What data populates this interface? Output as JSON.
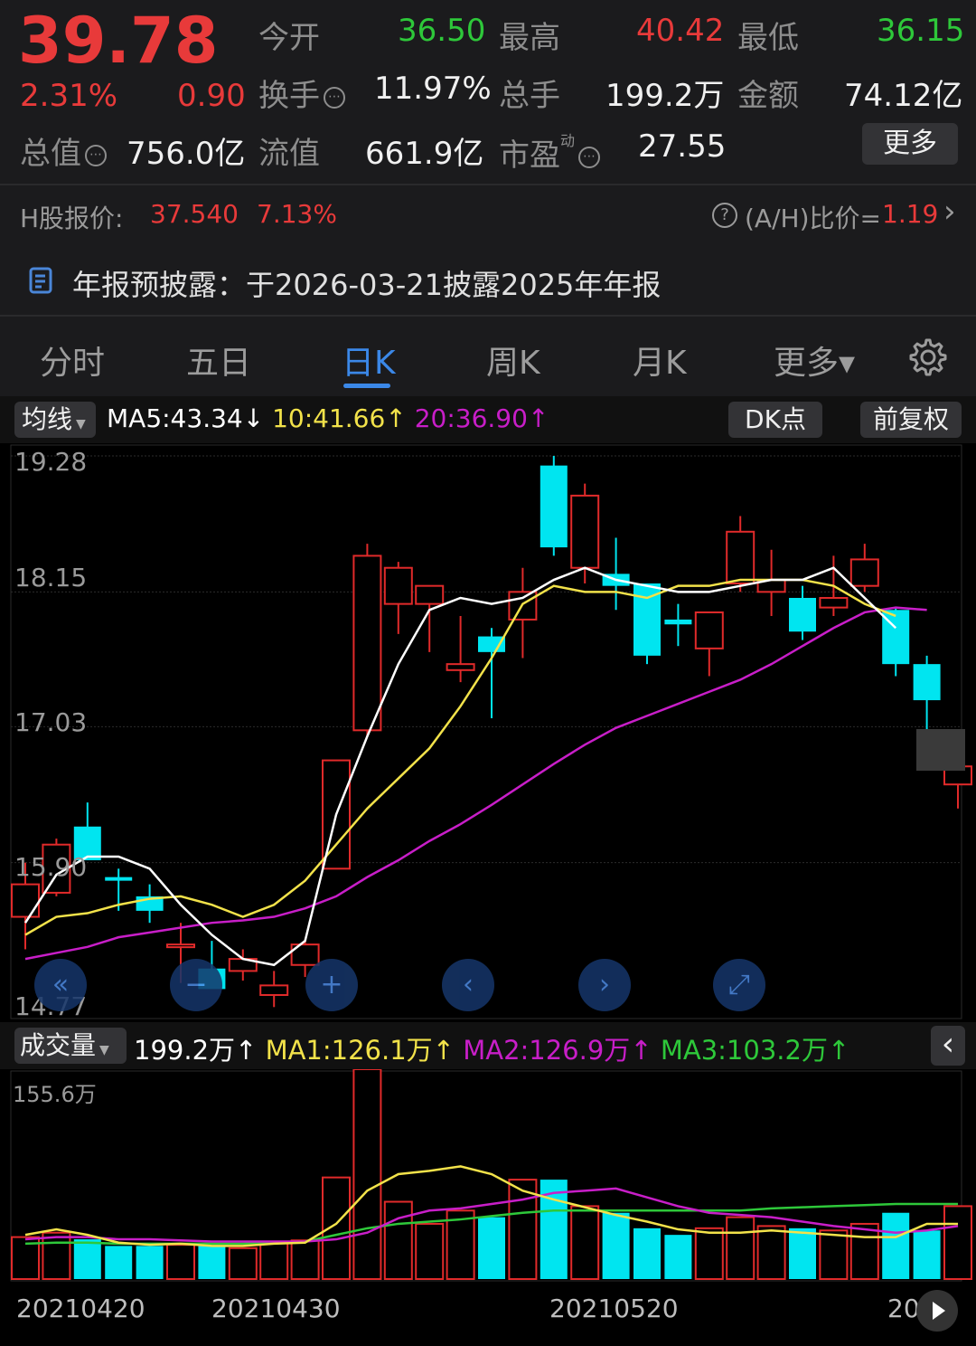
{
  "quote": {
    "price": "39.78",
    "change_pct": "2.31%",
    "change_amt": "0.90",
    "open_label": "今开",
    "open_value": "36.50",
    "high_label": "最高",
    "high_value": "40.42",
    "low_label": "最低",
    "low_value": "36.15",
    "turnover_label": "换手",
    "turnover_value": "11.97%",
    "volume_label": "总手",
    "volume_value": "199.2万",
    "amount_label": "金额",
    "amount_value": "74.12亿",
    "mktcap_label": "总值",
    "mktcap_value": "756.0亿",
    "float_label": "流值",
    "float_value": "661.9亿",
    "pe_label": "市盈",
    "pe_sup": "动",
    "pe_value": "27.55",
    "more_button": "更多",
    "info_glyph": "⋯"
  },
  "hshare": {
    "label": "H股报价:",
    "price": "37.540",
    "pct": "7.13%",
    "ratio_label": "(A/H)比价=",
    "ratio_value": "1.19",
    "help_glyph": "?",
    "arrow_glyph": "›"
  },
  "notice": {
    "text": "年报预披露：于2026-03-21披露2025年年报"
  },
  "tabs": [
    {
      "label": "分时",
      "active": false
    },
    {
      "label": "五日",
      "active": false
    },
    {
      "label": "日K",
      "active": true
    },
    {
      "label": "周K",
      "active": false
    },
    {
      "label": "月K",
      "active": false
    },
    {
      "label": "更多▾",
      "active": false
    }
  ],
  "ma_bar": {
    "selector": "均线",
    "ma5": "MA5:43.34",
    "ma5_arrow": "↓",
    "ma10": "10:41.66",
    "ma10_arrow": "↑",
    "ma20": "20:36.90",
    "ma20_arrow": "↑",
    "dk_button": "DK点",
    "adjust_button": "前复权"
  },
  "price_axis": [
    "19.28",
    "18.15",
    "17.03",
    "15.90",
    "14.77"
  ],
  "nav_buttons": {
    "first": "«",
    "zoom_out": "−",
    "zoom_in": "+",
    "prev": "‹",
    "next": "›",
    "fullscreen": "⤢"
  },
  "vol_bar": {
    "selector": "成交量",
    "vol": "199.2万",
    "vol_arrow": "↑",
    "ma1": "MA1:126.1万",
    "ma1_arrow": "↑",
    "ma2": "MA2:126.9万",
    "ma2_arrow": "↑",
    "ma3": "MA3:103.2万",
    "ma3_arrow": "↑",
    "collapse": "‹"
  },
  "vol_axis_top": "155.6万",
  "dates": [
    "20210420",
    "20210430",
    "20210520",
    "20"
  ],
  "colors": {
    "up": "#e02a2a",
    "down": "#00e5f0",
    "ma5": "#ffffff",
    "ma10": "#f2e24a",
    "ma20": "#c81ec8",
    "vma3": "#2ec83a",
    "accent": "#3b88e8"
  },
  "chart_data": {
    "type": "candlestick",
    "price_range": [
      14.77,
      19.28
    ],
    "candles": [
      {
        "o": 15.45,
        "h": 15.9,
        "l": 15.18,
        "c": 15.72
      },
      {
        "o": 15.65,
        "h": 16.1,
        "l": 15.62,
        "c": 16.05
      },
      {
        "o": 16.2,
        "h": 16.4,
        "l": 15.95,
        "c": 15.92
      },
      {
        "o": 15.78,
        "h": 15.85,
        "l": 15.5,
        "c": 15.75
      },
      {
        "o": 15.62,
        "h": 15.72,
        "l": 15.4,
        "c": 15.5
      },
      {
        "o": 15.22,
        "h": 15.4,
        "l": 14.9,
        "c": 15.22
      },
      {
        "o": 15.02,
        "h": 15.25,
        "l": 14.9,
        "c": 14.85
      },
      {
        "o": 15.0,
        "h": 15.18,
        "l": 14.92,
        "c": 15.1
      },
      {
        "o": 14.8,
        "h": 15.0,
        "l": 14.7,
        "c": 14.88
      },
      {
        "o": 15.05,
        "h": 15.25,
        "l": 14.95,
        "c": 15.22
      },
      {
        "o": 15.85,
        "h": 16.7,
        "l": 15.85,
        "c": 16.75
      },
      {
        "o": 17.0,
        "h": 18.55,
        "l": 16.95,
        "c": 18.45
      },
      {
        "o": 18.05,
        "h": 18.4,
        "l": 17.8,
        "c": 18.35
      },
      {
        "o": 18.05,
        "h": 18.2,
        "l": 17.65,
        "c": 18.2
      },
      {
        "o": 17.5,
        "h": 17.95,
        "l": 17.4,
        "c": 17.55
      },
      {
        "o": 17.78,
        "h": 17.85,
        "l": 17.1,
        "c": 17.65
      },
      {
        "o": 17.92,
        "h": 18.35,
        "l": 17.6,
        "c": 18.15
      },
      {
        "o": 19.2,
        "h": 19.28,
        "l": 18.45,
        "c": 18.52
      },
      {
        "o": 18.35,
        "h": 19.05,
        "l": 18.22,
        "c": 18.95
      },
      {
        "o": 18.3,
        "h": 18.6,
        "l": 18.0,
        "c": 18.2
      },
      {
        "o": 18.22,
        "h": 18.22,
        "l": 17.55,
        "c": 17.62
      },
      {
        "o": 17.92,
        "h": 18.05,
        "l": 17.7,
        "c": 17.88
      },
      {
        "o": 17.68,
        "h": 17.92,
        "l": 17.45,
        "c": 17.98
      },
      {
        "o": 18.22,
        "h": 18.78,
        "l": 18.15,
        "c": 18.65
      },
      {
        "o": 18.15,
        "h": 18.5,
        "l": 17.95,
        "c": 18.25
      },
      {
        "o": 18.1,
        "h": 18.2,
        "l": 17.75,
        "c": 17.82
      },
      {
        "o": 18.02,
        "h": 18.45,
        "l": 17.95,
        "c": 18.1
      },
      {
        "o": 18.2,
        "h": 18.55,
        "l": 18.15,
        "c": 18.42
      },
      {
        "o": 18.0,
        "h": 18.02,
        "l": 17.45,
        "c": 17.55
      },
      {
        "o": 17.55,
        "h": 17.62,
        "l": 17.0,
        "c": 17.25
      },
      {
        "o": 16.55,
        "h": 16.72,
        "l": 16.35,
        "c": 16.7
      }
    ],
    "ma5": [
      15.4,
      15.8,
      15.95,
      15.95,
      15.85,
      15.55,
      15.3,
      15.1,
      15.05,
      15.25,
      16.3,
      16.95,
      17.55,
      18.0,
      18.1,
      18.05,
      18.1,
      18.25,
      18.35,
      18.25,
      18.2,
      18.15,
      18.15,
      18.2,
      18.25,
      18.25,
      18.35,
      18.1,
      17.85,
      null,
      null
    ],
    "ma10": [
      15.3,
      15.45,
      15.48,
      15.55,
      15.6,
      15.62,
      15.55,
      15.45,
      15.55,
      15.75,
      16.05,
      16.35,
      16.6,
      16.85,
      17.2,
      17.6,
      18.05,
      18.2,
      18.15,
      18.15,
      18.1,
      18.2,
      18.2,
      18.25,
      18.25,
      18.25,
      18.2,
      18.05,
      17.95,
      null,
      null
    ],
    "ma20": [
      15.1,
      15.15,
      15.2,
      15.28,
      15.32,
      15.36,
      15.4,
      15.42,
      15.45,
      15.52,
      15.62,
      15.78,
      15.92,
      16.08,
      16.22,
      16.38,
      16.55,
      16.72,
      16.88,
      17.02,
      17.12,
      17.22,
      17.32,
      17.42,
      17.55,
      17.7,
      17.85,
      17.98,
      18.02,
      18.0,
      null
    ],
    "volume_max": "155.6万",
    "volumes": [
      0.38,
      0.42,
      0.36,
      0.3,
      0.3,
      0.31,
      0.3,
      0.28,
      0.34,
      0.35,
      0.92,
      1.9,
      0.7,
      0.5,
      0.62,
      0.56,
      0.9,
      0.9,
      0.66,
      0.6,
      0.46,
      0.4,
      0.46,
      0.56,
      0.48,
      0.46,
      0.44,
      0.5,
      0.6,
      0.44,
      0.66
    ],
    "vma1": [
      0.4,
      0.45,
      0.4,
      0.33,
      0.31,
      0.32,
      0.3,
      0.3,
      0.32,
      0.33,
      0.5,
      0.8,
      0.95,
      0.98,
      1.02,
      0.95,
      0.8,
      0.72,
      0.65,
      0.58,
      0.52,
      0.45,
      0.42,
      0.42,
      0.44,
      0.42,
      0.4,
      0.38,
      0.38,
      0.5,
      0.5
    ],
    "vma2": [
      0.36,
      0.38,
      0.38,
      0.36,
      0.36,
      0.35,
      0.34,
      0.34,
      0.34,
      0.34,
      0.36,
      0.42,
      0.55,
      0.62,
      0.64,
      0.68,
      0.72,
      0.78,
      0.8,
      0.82,
      0.74,
      0.66,
      0.6,
      0.58,
      0.56,
      0.52,
      0.48,
      0.45,
      0.42,
      0.44,
      0.48
    ],
    "vma3": [
      0.32,
      0.33,
      0.33,
      0.32,
      0.32,
      0.32,
      0.32,
      0.32,
      0.33,
      0.34,
      0.4,
      0.46,
      0.5,
      0.52,
      0.54,
      0.57,
      0.6,
      0.62,
      0.62,
      0.62,
      0.62,
      0.62,
      0.62,
      0.62,
      0.64,
      0.65,
      0.66,
      0.67,
      0.68,
      0.68,
      0.68
    ]
  }
}
